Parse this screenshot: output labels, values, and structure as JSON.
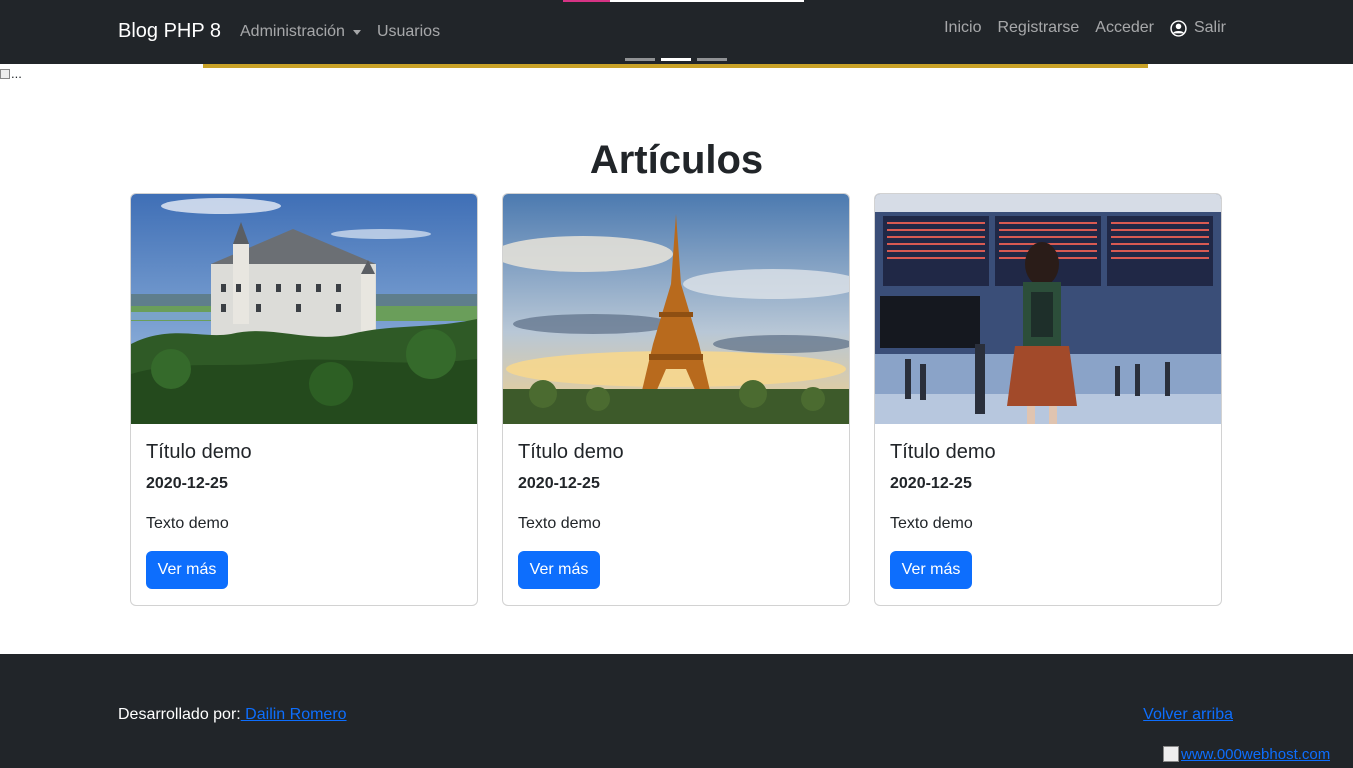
{
  "navbar": {
    "brand": "Blog PHP 8",
    "left_items": [
      {
        "label": "Administración",
        "dropdown": true
      },
      {
        "label": "Usuarios"
      }
    ],
    "right_items": [
      {
        "label": "Inicio"
      },
      {
        "label": "Registrarse"
      },
      {
        "label": "Acceder"
      },
      {
        "label": "Salir",
        "icon": "user-circle-icon"
      }
    ]
  },
  "carousel": {
    "broken_image_alt": "...",
    "accent_color": "#c9a227",
    "indicator_count": 3,
    "active_indicator": 2
  },
  "main": {
    "title": "Artículos",
    "cards": [
      {
        "image": "castle-photo",
        "title": "Título demo",
        "date": "2020-12-25",
        "text": "Texto demo",
        "button": "Ver más"
      },
      {
        "image": "eiffel-tower-photo",
        "title": "Título demo",
        "date": "2020-12-25",
        "text": "Texto demo",
        "button": "Ver más"
      },
      {
        "image": "airport-photo",
        "title": "Título demo",
        "date": "2020-12-25",
        "text": "Texto demo",
        "button": "Ver más"
      }
    ]
  },
  "footer": {
    "developed_by": "Desarrollado por:",
    "author_link": " Dailin Romero",
    "back_to_top": "Volver arriba",
    "host_badge": "www.000webhost.com"
  },
  "colors": {
    "dark": "#212529",
    "primary": "#0d6efd"
  }
}
